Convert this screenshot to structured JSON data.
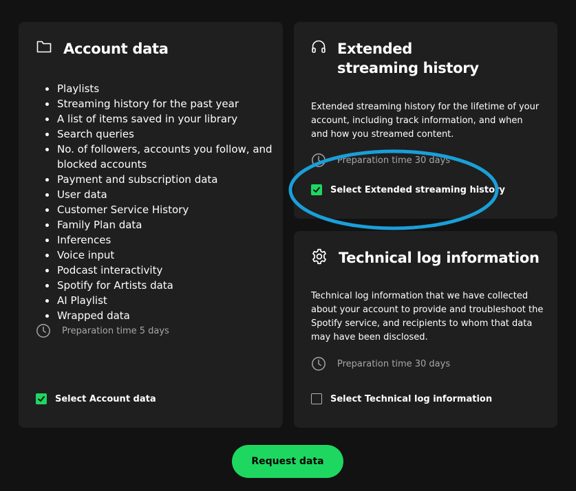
{
  "account": {
    "title": "Account data",
    "icon": "folder-icon",
    "items": [
      "Playlists",
      "Streaming history for the past year",
      "A list of items saved in your library",
      "Search queries",
      "No. of followers, accounts you follow, and blocked accounts",
      "Payment and subscription data",
      "User data",
      "Customer Service History",
      "Family Plan data",
      "Inferences",
      "Voice input",
      "Podcast interactivity",
      "Spotify for Artists data",
      "AI Playlist",
      "Wrapped data"
    ],
    "prep_time": "Preparation time 5 days",
    "select_label": "Select Account data",
    "selected": true
  },
  "extended": {
    "title_line1": "Extended",
    "title_line2": "streaming history",
    "icon": "headphones-icon",
    "description": "Extended streaming history for the lifetime of your account, including track information, and when and how you streamed content.",
    "prep_time": "Preparation time 30 days",
    "select_label": "Select Extended streaming history",
    "selected": true
  },
  "techlog": {
    "title": "Technical log information",
    "icon": "gear-icon",
    "description": "Technical log information that we have collected about your account to provide and troubleshoot the Spotify service, and recipients to whom that data may have been disclosed.",
    "prep_time": "Preparation time 30 days",
    "select_label": "Select Technical log information",
    "selected": false
  },
  "request_button": "Request data",
  "colors": {
    "background": "#121212",
    "card": "#1f1f1f",
    "accent": "#1ed760",
    "annotation": "#1a9fd8",
    "muted_text": "#a7a7a7"
  }
}
